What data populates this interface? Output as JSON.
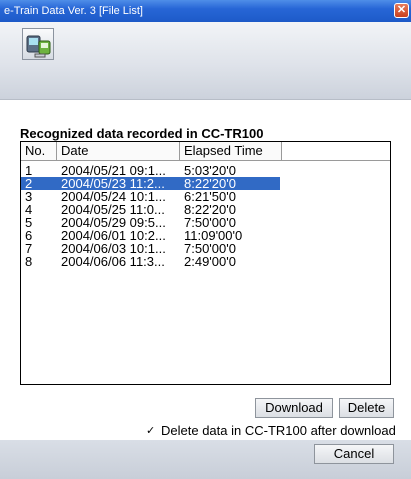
{
  "window": {
    "title": "e-Train Data Ver. 3 [File List]",
    "close_glyph": "✕"
  },
  "toolbar": {
    "tool_icon": "device-transfer-icon"
  },
  "main": {
    "heading": "Recognized data recorded in CC-TR100"
  },
  "list": {
    "columns": [
      "No.",
      "Date",
      "Elapsed Time"
    ],
    "rows": [
      {
        "no": "1",
        "date": "2004/05/21 09:1...",
        "elapsed": "5:03'20'0"
      },
      {
        "no": "2",
        "date": "2004/05/23 11:2...",
        "elapsed": "8:22'20'0",
        "selected": true
      },
      {
        "no": "3",
        "date": "2004/05/24 10:1...",
        "elapsed": "6:21'50'0"
      },
      {
        "no": "4",
        "date": "2004/05/25 11:0...",
        "elapsed": "8:22'20'0"
      },
      {
        "no": "5",
        "date": "2004/05/29 09:5...",
        "elapsed": "7:50'00'0"
      },
      {
        "no": "6",
        "date": "2004/06/01 10:2...",
        "elapsed": "11:09'00'0"
      },
      {
        "no": "7",
        "date": "2004/06/03 10:1...",
        "elapsed": "7:50'00'0"
      },
      {
        "no": "8",
        "date": "2004/06/06 11:3...",
        "elapsed": "2:49'00'0"
      }
    ]
  },
  "actions": {
    "download_label": "Download",
    "delete_label": "Delete",
    "delete_after_download_label": "Delete data in CC-TR100 after download",
    "delete_after_download_checked": true,
    "check_glyph": "✓",
    "cancel_label": "Cancel"
  },
  "colors": {
    "title_bar": "#2766d6",
    "selection": "#316ac5"
  }
}
